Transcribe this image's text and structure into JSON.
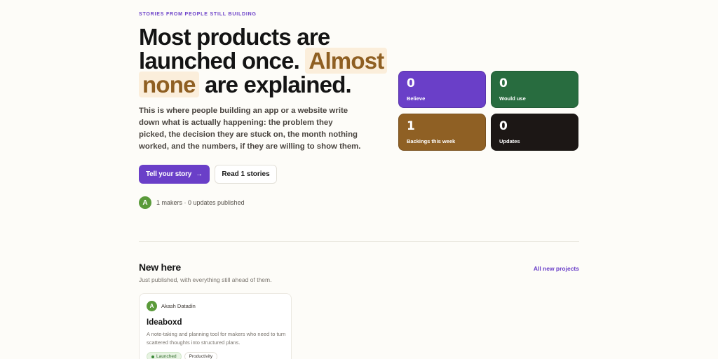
{
  "hero": {
    "eyebrow": "STORIES FROM PEOPLE STILL BUILDING",
    "headline_part1": "Most products are launched once.",
    "headline_highlight1": "Almost",
    "headline_highlight2": "none",
    "headline_part2": "are explained.",
    "lede": "This is where people building an app or a website write down what is actually happening: the problem they picked, the decision they are stuck on, the month nothing worked, and the numbers, if they are willing to show them.",
    "primary_button": "Tell your story",
    "primary_arrow": "→",
    "secondary_button": "Read 1 stories",
    "avatar_letter": "A",
    "meta": "1 makers · 0 updates published"
  },
  "stats": [
    {
      "value": "0",
      "label": "Believe",
      "color": "#6a3fc8"
    },
    {
      "value": "0",
      "label": "Would use",
      "color": "#286c3f"
    },
    {
      "value": "1",
      "label": "Backings this week",
      "color": "#8f6024"
    },
    {
      "value": "0",
      "label": "Updates",
      "color": "#1c1715"
    }
  ],
  "new_here": {
    "title": "New here",
    "subtitle": "Just published, with everything still ahead of them.",
    "link": "All new projects",
    "card": {
      "avatar_letter": "A",
      "author": "Akash Datadin",
      "title": "Ideaboxd",
      "description": "A note-taking and planning tool for makers who need to turn scattered thoughts into structured plans.",
      "tags": [
        "Launched",
        "Productivity"
      ]
    }
  },
  "colors": {
    "accent": "#6a3fc8",
    "background": "#fdfcf8",
    "highlight_bg": "#fbeedb",
    "highlight_text": "#8f5f22"
  }
}
